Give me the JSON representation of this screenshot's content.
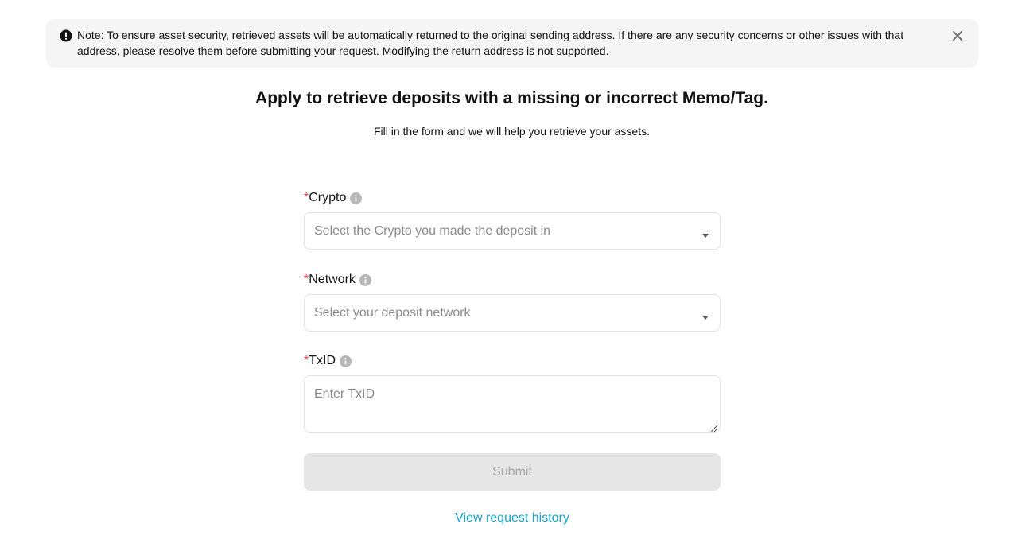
{
  "notice": {
    "text": "Note: To ensure asset security, retrieved assets will be automatically returned to the original sending address. If there are any security concerns or other issues with that address, please resolve them before submitting your request. Modifying the return address is not supported.",
    "icon": "alert-icon",
    "close_icon": "close-icon"
  },
  "header": {
    "title": "Apply to retrieve deposits with a missing or incorrect Memo/Tag.",
    "subtitle": "Fill in the form and we will help you retrieve your assets."
  },
  "form": {
    "required_mark": "*",
    "crypto": {
      "label": "Crypto",
      "placeholder": "Select the Crypto you made the deposit in"
    },
    "network": {
      "label": "Network",
      "placeholder": "Select your deposit network"
    },
    "txid": {
      "label": "TxID",
      "placeholder": "Enter TxID",
      "value": ""
    },
    "submit_label": "Submit"
  },
  "footer": {
    "history_link": "View request history"
  },
  "colors": {
    "required": "#e5484d",
    "link": "#1aa3c8",
    "notice_bg": "#f5f5f5",
    "submit_disabled_bg": "#e6e6e6"
  }
}
